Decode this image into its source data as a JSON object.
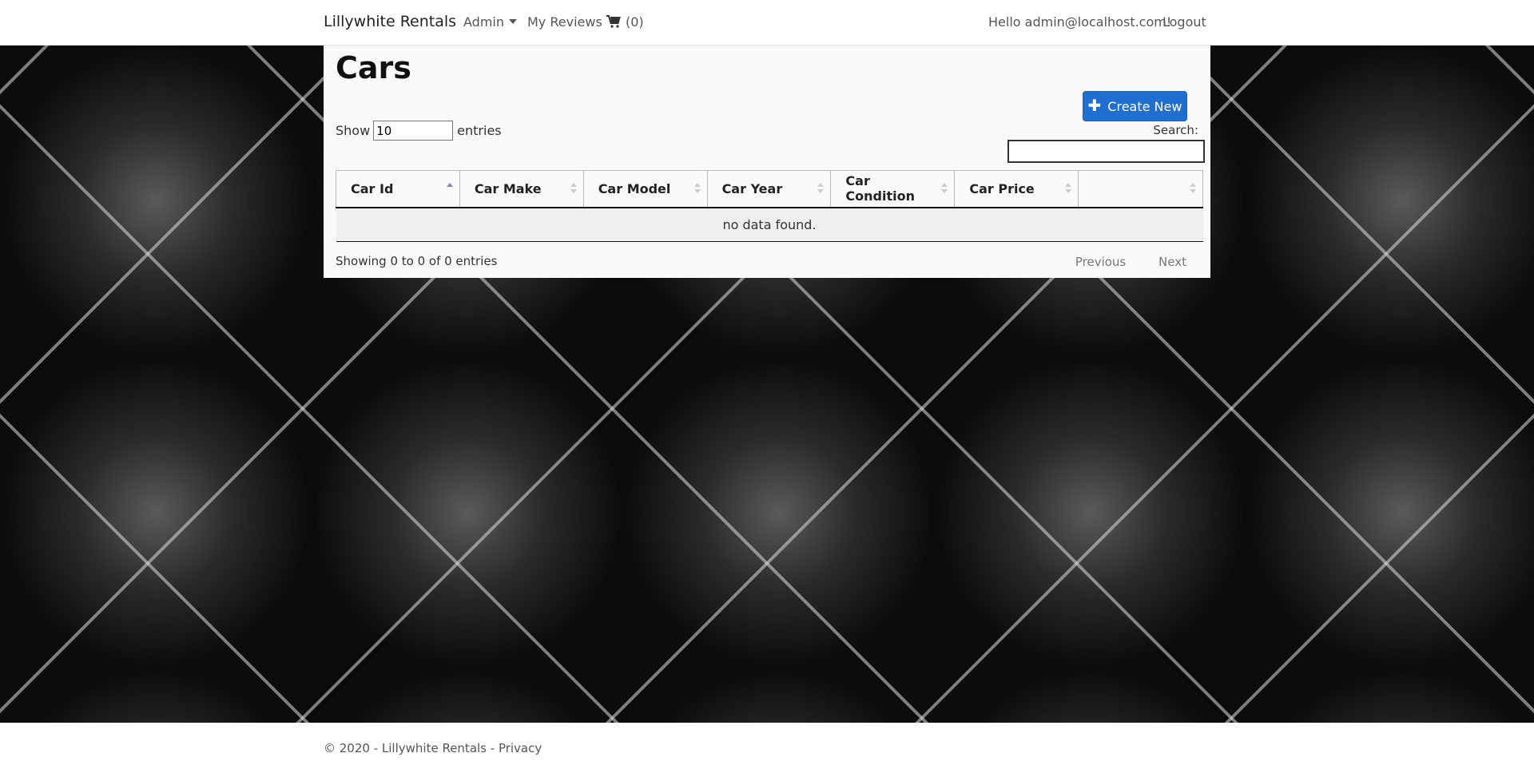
{
  "nav": {
    "brand": "Lillywhite Rentals",
    "admin": "Admin",
    "reviews": "My Reviews",
    "cart_count": "(0)",
    "greeting": "Hello admin@localhost.com!",
    "logout": "Logout"
  },
  "main": {
    "title": "Cars",
    "create_label": "Create New",
    "show_label": "Show",
    "entries_value": "10",
    "entries_label": "entries",
    "search_label": "Search:",
    "search_value": "",
    "columns": [
      "Car Id",
      "Car Make",
      "Car Model",
      "Car Year",
      "Car Condition",
      "Car Price",
      ""
    ],
    "empty_message": "no data found.",
    "info": "Showing 0 to 0 of 0 entries",
    "prev_label": "Previous",
    "next_label": "Next"
  },
  "footer": {
    "copyright": "© 2020 - Lillywhite Rentals - ",
    "privacy": "Privacy"
  },
  "colors": {
    "accent": "#1f6fd1"
  }
}
